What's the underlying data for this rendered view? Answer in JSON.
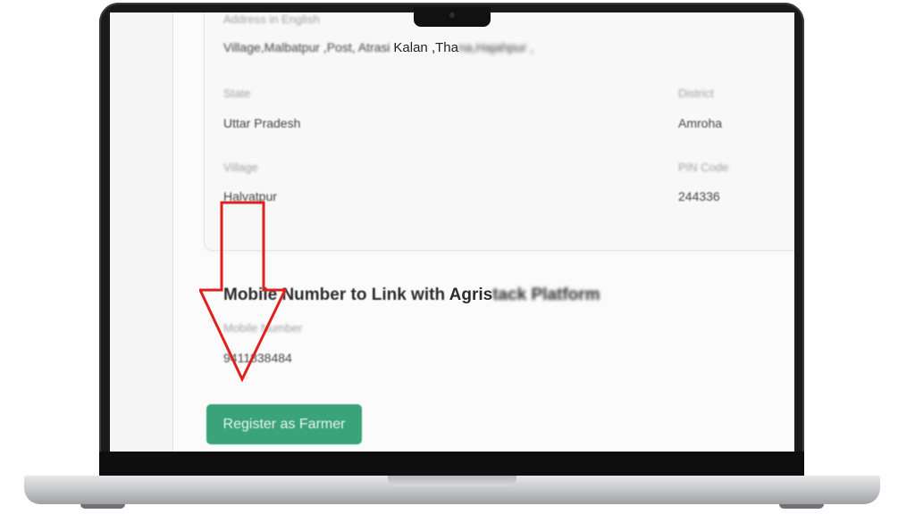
{
  "address": {
    "label": "Address in English",
    "value_part1": "Village,Malbatpur ,Post, Atrasi ",
    "value_clear": "Kalan ,Tha",
    "value_part2": "na,Hajahpur ,"
  },
  "state": {
    "label": "State",
    "value": "Uttar Pradesh"
  },
  "district": {
    "label": "District",
    "value": "Amroha"
  },
  "village": {
    "label": "Village",
    "value": "Halvatpur"
  },
  "pin": {
    "label": "PIN Code",
    "value": "244336"
  },
  "mobile_section": {
    "title_part1": "Mobile Number to Link with ",
    "title_clear": "Agris",
    "title_part2": "tack Platform",
    "label": "Mobile Number",
    "value": "9411838484"
  },
  "register_label": "Register as Farmer",
  "annotation": {
    "color": "#e0201c",
    "icon": "down-arrow-icon"
  }
}
